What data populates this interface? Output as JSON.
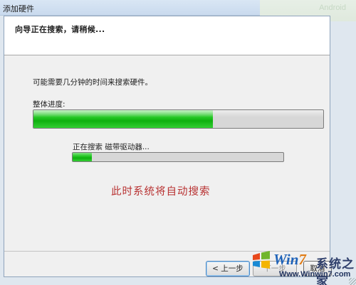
{
  "window": {
    "title": "添加硬件"
  },
  "header": {
    "heading": "向导正在搜索，请稍候..."
  },
  "body": {
    "info_text": "可能需要几分钟的时间来搜索硬件。",
    "overall_label": "整体进度:",
    "overall_progress": 0.62,
    "searching_label": "正在搜索 磁带驱动器...",
    "device_progress": 0.09
  },
  "annotation": "此时系统将自动搜索",
  "buttons": {
    "back": "< 上一步",
    "next": "下一步",
    "cancel": "取消"
  },
  "watermark": {
    "brand_prefix": "Win",
    "brand_seven": "7",
    "cn_text": "系统之家",
    "url": "Www.Winwin7.com"
  },
  "background": {
    "ghost_text": "Android"
  },
  "colors": {
    "progress_fill": "#22c422",
    "annotation": "#b83232",
    "header_bg": "#ffffff",
    "client_bg": "#f0f0f0"
  }
}
